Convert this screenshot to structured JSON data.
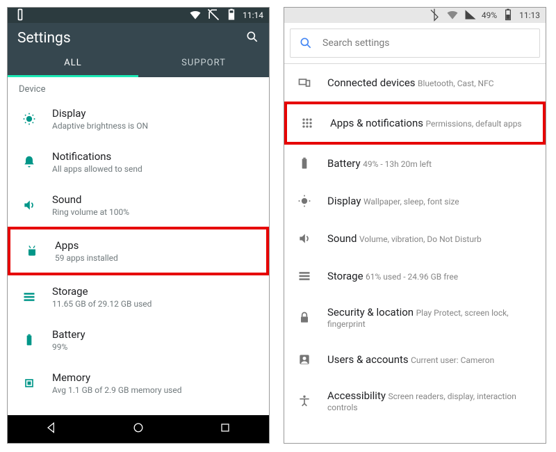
{
  "left": {
    "status": {
      "time": "11:14"
    },
    "header": {
      "title": "Settings"
    },
    "tabs": {
      "all": "ALL",
      "support": "SUPPORT"
    },
    "section": "Device",
    "items": {
      "display": {
        "title": "Display",
        "sub": "Adaptive brightness is ON"
      },
      "notifications": {
        "title": "Notifications",
        "sub": "All apps allowed to send"
      },
      "sound": {
        "title": "Sound",
        "sub": "Ring volume at 100%"
      },
      "apps": {
        "title": "Apps",
        "sub": "59 apps installed"
      },
      "storage": {
        "title": "Storage",
        "sub": "11.65 GB of 29.12 GB used"
      },
      "battery": {
        "title": "Battery",
        "sub": "99%"
      },
      "memory": {
        "title": "Memory",
        "sub": "Avg 1.1 GB of 2.9 GB memory used"
      }
    }
  },
  "right": {
    "status": {
      "pct": "49%",
      "time": "11:13"
    },
    "search_placeholder": "Search settings",
    "items": {
      "connected": {
        "title": "Connected devices",
        "sub": "Bluetooth, Cast, NFC"
      },
      "apps": {
        "title": "Apps & notifications",
        "sub": "Permissions, default apps"
      },
      "battery": {
        "title": "Battery",
        "sub": "49% - 13h 20m left"
      },
      "display": {
        "title": "Display",
        "sub": "Wallpaper, sleep, font size"
      },
      "sound": {
        "title": "Sound",
        "sub": "Volume, vibration, Do Not Disturb"
      },
      "storage": {
        "title": "Storage",
        "sub": "61% used - 24.96 GB free"
      },
      "security": {
        "title": "Security & location",
        "sub": "Play Protect, screen lock, fingerprint"
      },
      "users": {
        "title": "Users & accounts",
        "sub": "Current user: Cameron"
      },
      "accessibility": {
        "title": "Accessibility",
        "sub": "Screen readers, display, interaction controls"
      }
    }
  }
}
